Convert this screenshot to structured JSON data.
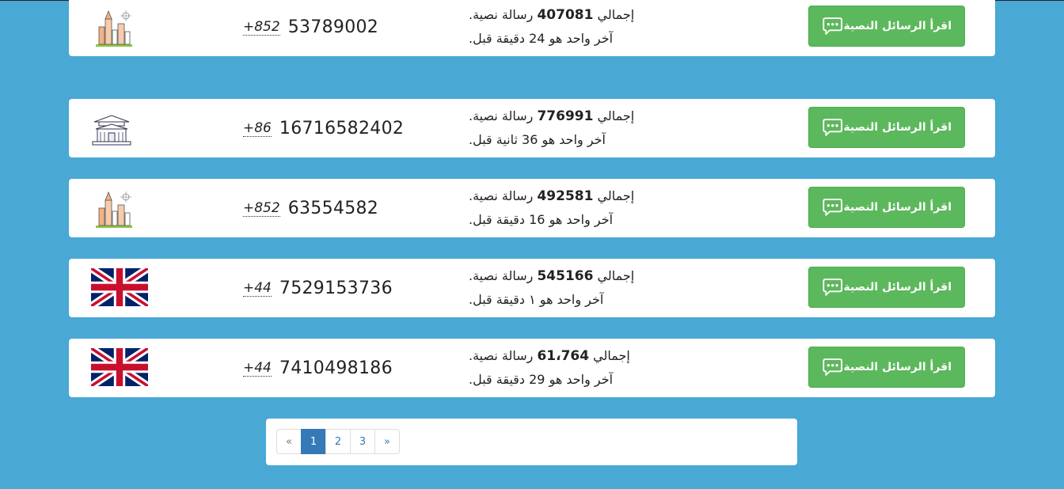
{
  "button_label": "اقرأ الرسائل النصية",
  "rows": [
    {
      "flag": "hong-kong-skyline-icon",
      "cc": "+852",
      "number": "53789002",
      "total_prefix": "إجمالي",
      "total": "407081",
      "total_suffix": "رسالة نصية.",
      "last": "آخر واحد هو 24 دقيقة قبل."
    },
    {
      "flag": "china-temple-icon",
      "cc": "+86",
      "number": "16716582402",
      "total_prefix": "إجمالي",
      "total": "776991",
      "total_suffix": "رسالة نصية.",
      "last": "آخر واحد هو 36 ثانية قبل."
    },
    {
      "flag": "hong-kong-skyline-icon",
      "cc": "+852",
      "number": "63554582",
      "total_prefix": "إجمالي",
      "total": "492581",
      "total_suffix": "رسالة نصية.",
      "last": "آخر واحد هو 16 دقيقة قبل."
    },
    {
      "flag": "uk-flag-icon",
      "cc": "+44",
      "number": "7529153736",
      "total_prefix": "إجمالي",
      "total": "545166",
      "total_suffix": "رسالة نصية.",
      "last": "آخر واحد هو ١ دقيقة قبل."
    },
    {
      "flag": "uk-flag-icon",
      "cc": "+44",
      "number": "7410498186",
      "total_prefix": "إجمالي",
      "total": "61،764",
      "total_suffix": "رسالة نصية.",
      "last": "آخر واحد هو 29 دقيقة قبل."
    }
  ],
  "pagination": {
    "prev": "«",
    "pages": [
      "1",
      "2",
      "3"
    ],
    "current": "1",
    "next": "»"
  },
  "colors": {
    "background": "#4aa8d5",
    "button": "#5cb85c",
    "active_page": "#337ab7"
  }
}
